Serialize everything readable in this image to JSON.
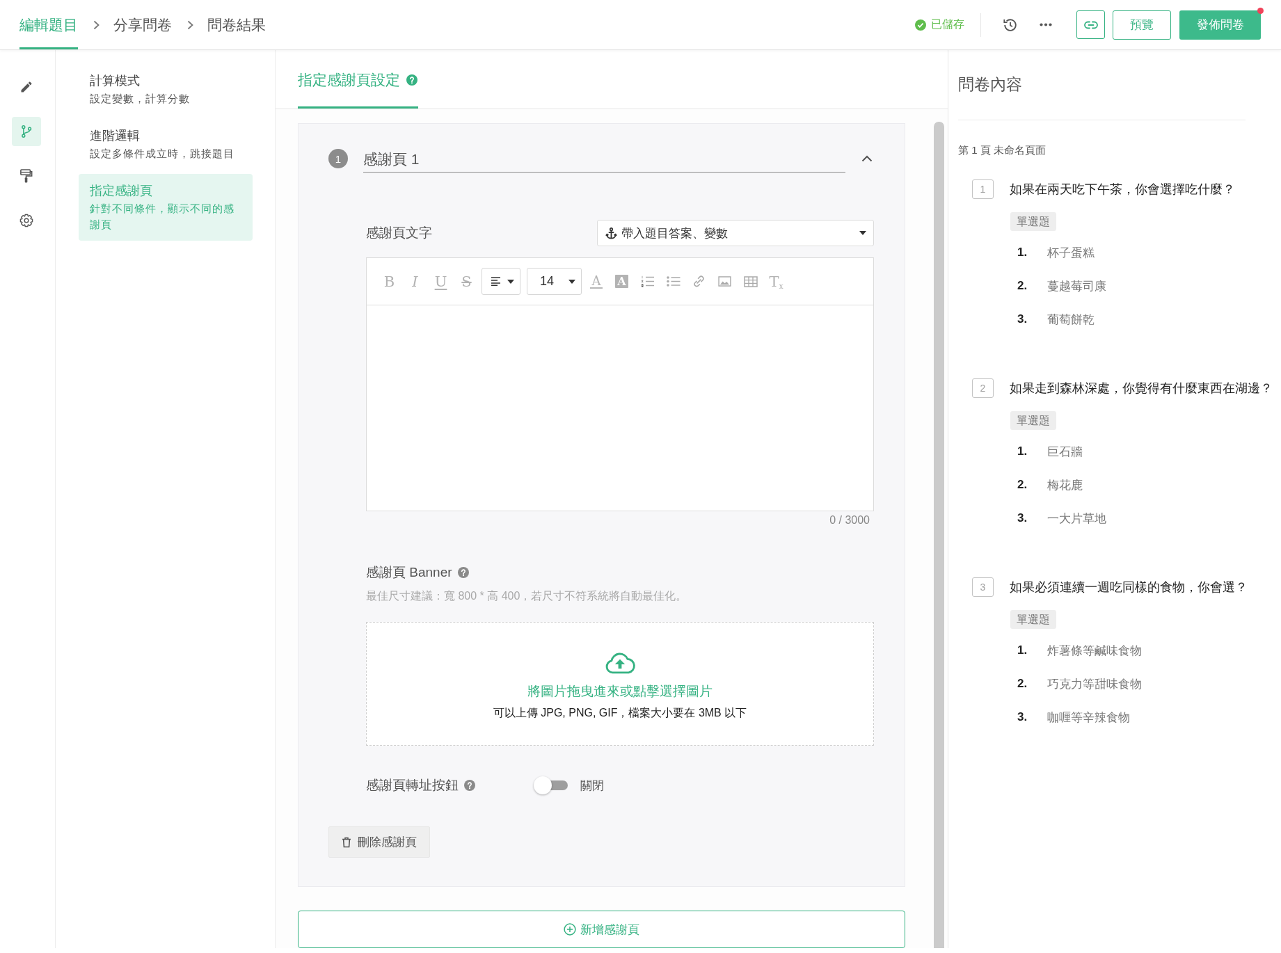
{
  "topbar": {
    "crumbs": [
      {
        "label": "編輯題目",
        "selected": true
      },
      {
        "label": "分享問卷",
        "selected": false
      },
      {
        "label": "問卷結果",
        "selected": false
      }
    ],
    "save_status": "已儲存",
    "preview_button": "預覽",
    "publish_button": {
      "label": "發佈問卷",
      "notification": true
    }
  },
  "nav_rail": {
    "items": [
      {
        "kind": "edit",
        "selected": false
      },
      {
        "kind": "logic",
        "selected": true
      },
      {
        "kind": "style",
        "selected": false
      },
      {
        "kind": "settings",
        "selected": false
      }
    ]
  },
  "logic_menu": {
    "items": [
      {
        "title": "計算模式",
        "description": "設定變數，計算分數",
        "selected": false
      },
      {
        "title": "進階邏輯",
        "description": "設定多條件成立時，跳接題目",
        "selected": false
      },
      {
        "title": "指定感謝頁",
        "description": "針對不同條件，顯示不同的感謝頁",
        "selected": true
      }
    ]
  },
  "settings_panel": {
    "tab": "指定感謝頁設定",
    "thank_you_pages": [
      {
        "number": "1",
        "title": "感謝頁 1",
        "expanded": true,
        "text_label": "感謝頁文字",
        "insert_menu": "帶入題目答案、變數",
        "toolbar": [
          {
            "kind": "bold",
            "glyph": "B"
          },
          {
            "kind": "italic",
            "glyph": "I"
          },
          {
            "kind": "underline",
            "glyph": "U"
          },
          {
            "kind": "strike",
            "glyph": "S"
          },
          {
            "kind": "align"
          },
          {
            "kind": "font_size",
            "value": "14"
          },
          {
            "kind": "text_color",
            "glyph": "A"
          },
          {
            "kind": "highlight",
            "glyph": "A"
          },
          {
            "kind": "ordered_list"
          },
          {
            "kind": "bullet_list"
          },
          {
            "kind": "link"
          },
          {
            "kind": "image"
          },
          {
            "kind": "table"
          },
          {
            "kind": "clear_format",
            "glyph": "T$_{x}$"
          }
        ],
        "counter": "0 / 3000",
        "banner_label": "感謝頁 Banner",
        "banner_hint": "最佳尺寸建議：寬 800 * 高 400，若尺寸不符系統將自動最佳化。",
        "upload_prompt": "將圖片拖曳進來或點擊選擇圖片",
        "upload_note": "可以上傳 JPG, PNG, GIF，檔案大小要在 3MB 以下",
        "redirect_label": "感謝頁轉址按鈕",
        "redirect_on": false,
        "redirect_state": "關閉",
        "delete_button": "刪除感謝頁"
      }
    ],
    "add_button": "新增感謝頁"
  },
  "outline": {
    "title": "問卷內容",
    "pages": [
      {
        "title": "第 1 頁 未命名頁面",
        "questions": [
          {
            "number": "1",
            "text": "如果在兩天吃下午茶，你會選擇吃什麼？",
            "type": "單選題",
            "options": [
              {
                "number": "1.",
                "label": "杯子蛋糕"
              },
              {
                "number": "2.",
                "label": "蔓越莓司康"
              },
              {
                "number": "3.",
                "label": "葡萄餅乾"
              }
            ]
          },
          {
            "number": "2",
            "text": "如果走到森林深處，你覺得有什麼東西在湖邊？",
            "type": "單選題",
            "options": [
              {
                "number": "1.",
                "label": "巨石牆"
              },
              {
                "number": "2.",
                "label": "梅花鹿"
              },
              {
                "number": "3.",
                "label": "一大片草地"
              }
            ]
          },
          {
            "number": "3",
            "text": "如果必須連續一週吃同樣的食物，你會選？",
            "type": "單選題",
            "options": [
              {
                "number": "1.",
                "label": "炸薯條等鹹味食物"
              },
              {
                "number": "2.",
                "label": "巧克力等甜味食物"
              },
              {
                "number": "3.",
                "label": "咖喱等辛辣食物"
              }
            ]
          }
        ]
      }
    ]
  }
}
